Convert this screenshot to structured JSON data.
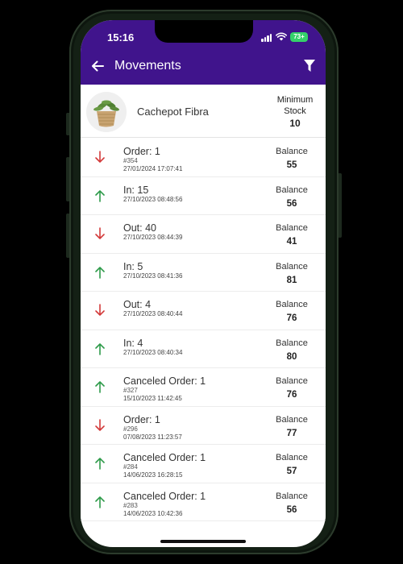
{
  "status_bar": {
    "time": "15:16",
    "battery": "73+"
  },
  "app_bar": {
    "title": "Movements"
  },
  "product": {
    "name": "Cachepot Fibra",
    "min_stock_label_line1": "Minimum",
    "min_stock_label_line2": "Stock",
    "min_stock_value": "10"
  },
  "balance_label": "Balance",
  "colors": {
    "header": "#40148c",
    "in_arrow": "#2e9b4a",
    "out_arrow": "#d33a3a",
    "battery": "#35d16a"
  },
  "movements": [
    {
      "direction": "out",
      "type": "Order: 1",
      "ref": "#354",
      "date": "27/01/2024 17:07:41",
      "balance": "55"
    },
    {
      "direction": "in",
      "type": "In: 15",
      "ref": "",
      "date": "27/10/2023 08:48:56",
      "balance": "56"
    },
    {
      "direction": "out",
      "type": "Out: 40",
      "ref": "",
      "date": "27/10/2023 08:44:39",
      "balance": "41"
    },
    {
      "direction": "in",
      "type": "In: 5",
      "ref": "",
      "date": "27/10/2023 08:41:36",
      "balance": "81"
    },
    {
      "direction": "out",
      "type": "Out: 4",
      "ref": "",
      "date": "27/10/2023 08:40:44",
      "balance": "76"
    },
    {
      "direction": "in",
      "type": "In: 4",
      "ref": "",
      "date": "27/10/2023 08:40:34",
      "balance": "80"
    },
    {
      "direction": "in",
      "type": "Canceled Order: 1",
      "ref": "#327",
      "date": "15/10/2023 11:42:45",
      "balance": "76"
    },
    {
      "direction": "out",
      "type": "Order: 1",
      "ref": "#296",
      "date": "07/08/2023 11:23:57",
      "balance": "77"
    },
    {
      "direction": "in",
      "type": "Canceled Order: 1",
      "ref": "#284",
      "date": "14/06/2023 16:28:15",
      "balance": "57"
    },
    {
      "direction": "in",
      "type": "Canceled Order: 1",
      "ref": "#283",
      "date": "14/06/2023 10:42:36",
      "balance": "56"
    }
  ]
}
